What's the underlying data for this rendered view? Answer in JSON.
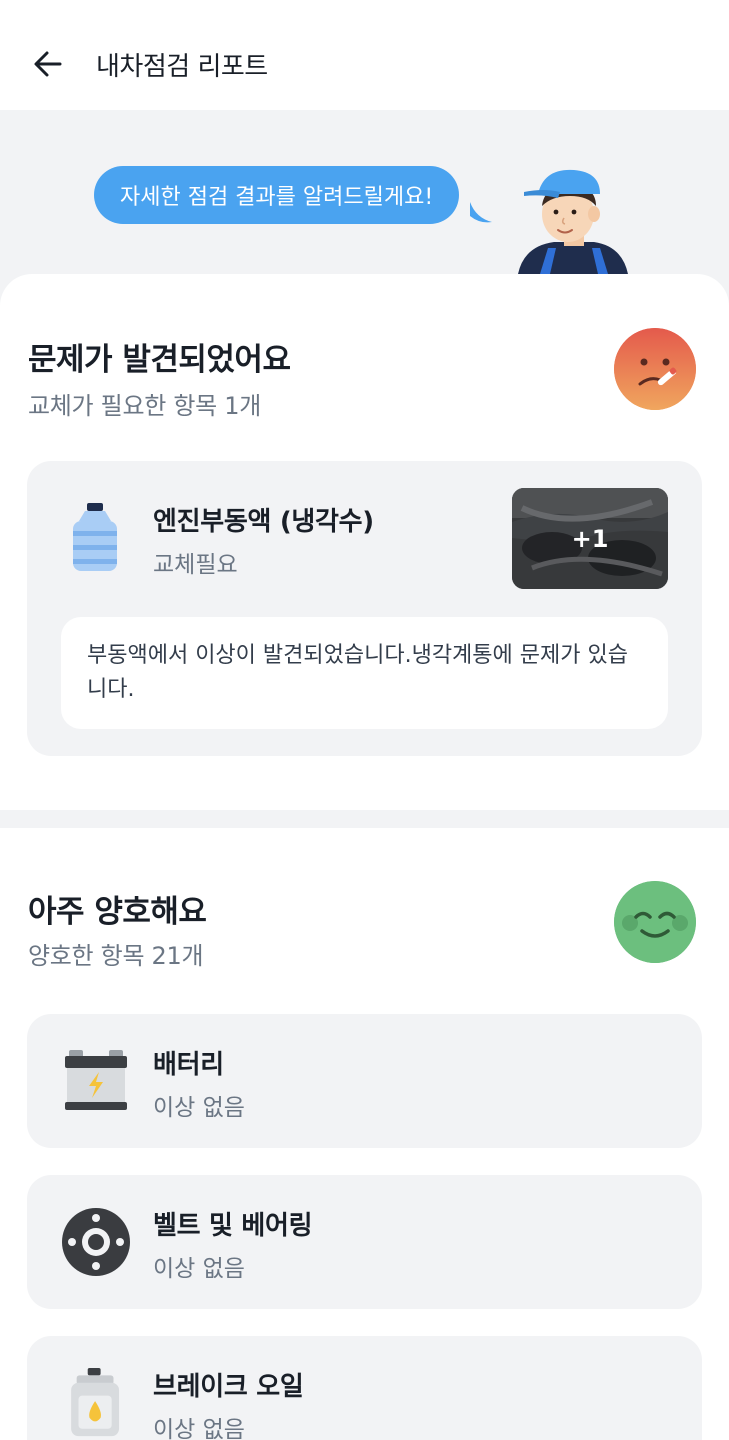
{
  "header": {
    "title": "내차점검 리포트",
    "back_icon": "arrow-left-icon"
  },
  "hero": {
    "bubble_text": "자세한 점검 결과를 알려드릴게요!"
  },
  "problem_section": {
    "title": "문제가 발견되었어요",
    "subtitle": "교체가 필요한 항목 1개",
    "face_icon": "sick-face-icon",
    "item": {
      "name": "엔진부동액 (냉각수)",
      "status": "교체필요",
      "icon": "water-bottle-icon",
      "photo_count": "+1",
      "description": "부동액에서 이상이 발견되었습니다.냉각계통에 문제가 있습니다."
    }
  },
  "good_section": {
    "title": "아주 양호해요",
    "subtitle": "양호한 항목 21개",
    "face_icon": "happy-face-icon",
    "items": [
      {
        "name": "배터리",
        "status": "이상 없음",
        "icon": "battery-icon"
      },
      {
        "name": "벨트 및 베어링",
        "status": "이상 없음",
        "icon": "bearing-icon"
      },
      {
        "name": "브레이크 오일",
        "status": "이상 없음",
        "icon": "oil-can-icon"
      }
    ]
  },
  "colors": {
    "accent": "#4aa3f0",
    "background": "#f2f3f5",
    "sick": "#e55d4b",
    "happy": "#6cbf7e"
  }
}
